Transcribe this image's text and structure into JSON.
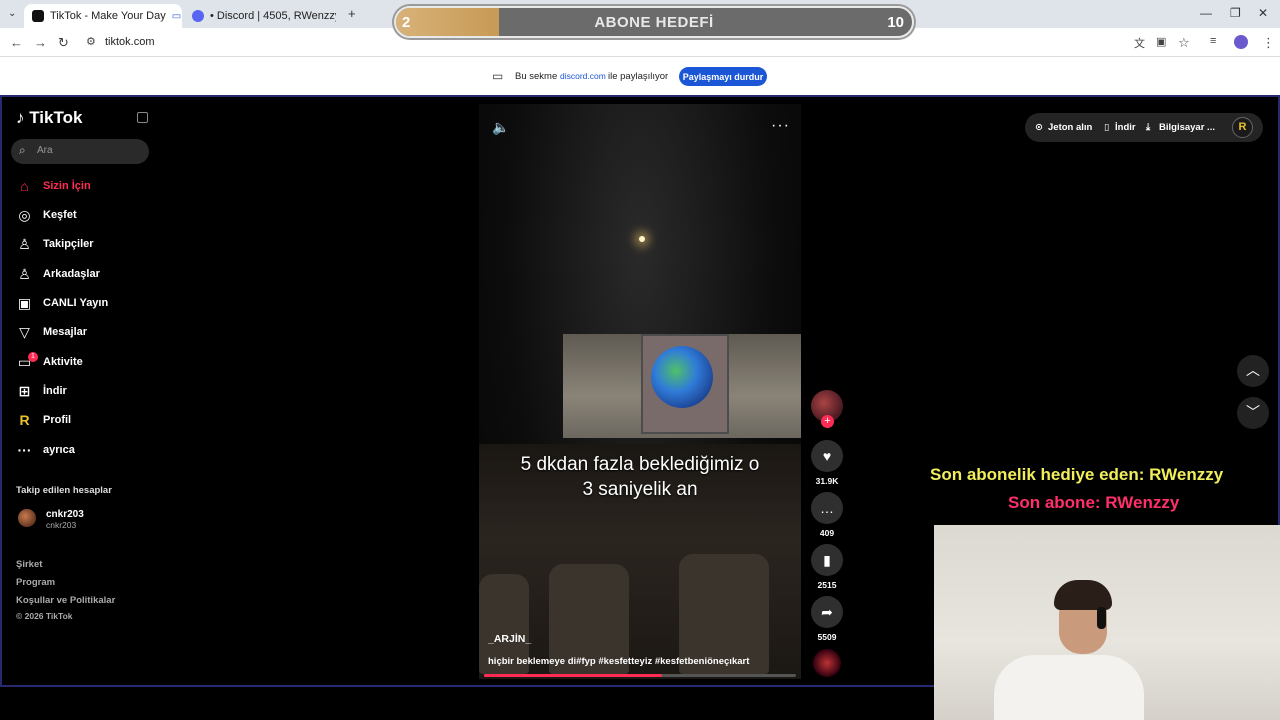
{
  "browser": {
    "tabs": [
      {
        "title": "TikTok - Make Your Day"
      },
      {
        "title": "• Discord | 4505, RWenzzy."
      }
    ],
    "url": "tiktok.com",
    "share_notice": {
      "prefix": "Bu sekme",
      "domain": "discord.com",
      "suffix": "ile paylaşılıyor",
      "stop_label": "Paylaşmayı durdur"
    }
  },
  "goal_overlay": {
    "current": "2",
    "target": "10",
    "title": "ABONE HEDEFİ",
    "progress_fraction": 0.2
  },
  "tiktok": {
    "logo": "TikTok",
    "search_placeholder": "Ara",
    "nav": [
      {
        "label": "Sizin İçin",
        "icon": "home-icon"
      },
      {
        "label": "Keşfet",
        "icon": "compass-icon"
      },
      {
        "label": "Takipçiler",
        "icon": "user-icon"
      },
      {
        "label": "Arkadaşlar",
        "icon": "users-icon"
      },
      {
        "label": "CANLI Yayın",
        "icon": "live-icon"
      },
      {
        "label": "Mesajlar",
        "icon": "send-icon"
      },
      {
        "label": "Aktivite",
        "icon": "activity-icon"
      },
      {
        "label": "İndir",
        "icon": "download-icon"
      },
      {
        "label": "Profil",
        "icon": "profile-icon"
      },
      {
        "label": "ayrıca",
        "icon": "more-icon"
      }
    ],
    "activity_badge": "1",
    "following": {
      "title": "Takip edilen hesaplar",
      "accounts": [
        {
          "name": "cnkr203",
          "username": "cnkr203"
        }
      ]
    },
    "footer": [
      "Şirket",
      "Program",
      "Koşullar ve Politikalar",
      "© 2026 TikTok"
    ],
    "top_right": {
      "coins": "Jeton alın",
      "download": "İndir",
      "desktop": "Bilgisayar ..."
    },
    "video": {
      "caption_line1": "5 dkdan fazla beklediğimiz o",
      "caption_line2": "3 saniyelik an",
      "author": "_ARJİN_",
      "description": "hiçbir beklemeye di#fyp #kesfetteyiz #kesfetbeniöneçıkart",
      "progress_fraction": 0.57
    },
    "actions": {
      "likes": "31.9K",
      "comments": "409",
      "saves": "2515",
      "shares": "5509"
    }
  },
  "stream_overlay": {
    "last_gift": "Son abonelik hediye eden: RWenzzy",
    "last_sub": "Son abone: RWenzzy"
  }
}
